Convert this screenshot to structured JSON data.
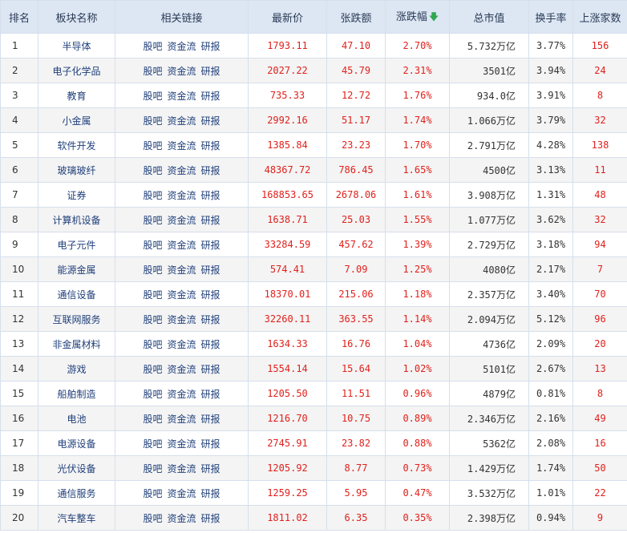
{
  "columns": [
    "排名",
    "板块名称",
    "相关链接",
    "最新价",
    "张跌额",
    "涨跌幅",
    "总市值",
    "换手率",
    "上涨家数"
  ],
  "sort_icon": "down-arrow-icon",
  "rows": [
    {
      "rank": "1",
      "name": "半导体",
      "links": [
        "股吧",
        "资金流",
        "研报"
      ],
      "price": "1793.11",
      "chg": "47.10",
      "pct": "2.70%",
      "cap": "5.732万亿",
      "turn": "3.77%",
      "up": "156"
    },
    {
      "rank": "2",
      "name": "电子化学品",
      "links": [
        "股吧",
        "资金流",
        "研报"
      ],
      "price": "2027.22",
      "chg": "45.79",
      "pct": "2.31%",
      "cap": "3501亿",
      "turn": "3.94%",
      "up": "24"
    },
    {
      "rank": "3",
      "name": "教育",
      "links": [
        "股吧",
        "资金流",
        "研报"
      ],
      "price": "735.33",
      "chg": "12.72",
      "pct": "1.76%",
      "cap": "934.0亿",
      "turn": "3.91%",
      "up": "8"
    },
    {
      "rank": "4",
      "name": "小金属",
      "links": [
        "股吧",
        "资金流",
        "研报"
      ],
      "price": "2992.16",
      "chg": "51.17",
      "pct": "1.74%",
      "cap": "1.066万亿",
      "turn": "3.79%",
      "up": "32"
    },
    {
      "rank": "5",
      "name": "软件开发",
      "links": [
        "股吧",
        "资金流",
        "研报"
      ],
      "price": "1385.84",
      "chg": "23.23",
      "pct": "1.70%",
      "cap": "2.791万亿",
      "turn": "4.28%",
      "up": "138"
    },
    {
      "rank": "6",
      "name": "玻璃玻纤",
      "links": [
        "股吧",
        "资金流",
        "研报"
      ],
      "price": "48367.72",
      "chg": "786.45",
      "pct": "1.65%",
      "cap": "4500亿",
      "turn": "3.13%",
      "up": "11"
    },
    {
      "rank": "7",
      "name": "证券",
      "links": [
        "股吧",
        "资金流",
        "研报"
      ],
      "price": "168853.65",
      "chg": "2678.06",
      "pct": "1.61%",
      "cap": "3.908万亿",
      "turn": "1.31%",
      "up": "48"
    },
    {
      "rank": "8",
      "name": "计算机设备",
      "links": [
        "股吧",
        "资金流",
        "研报"
      ],
      "price": "1638.71",
      "chg": "25.03",
      "pct": "1.55%",
      "cap": "1.077万亿",
      "turn": "3.62%",
      "up": "32"
    },
    {
      "rank": "9",
      "name": "电子元件",
      "links": [
        "股吧",
        "资金流",
        "研报"
      ],
      "price": "33284.59",
      "chg": "457.62",
      "pct": "1.39%",
      "cap": "2.729万亿",
      "turn": "3.18%",
      "up": "94"
    },
    {
      "rank": "10",
      "name": "能源金属",
      "links": [
        "股吧",
        "资金流",
        "研报"
      ],
      "price": "574.41",
      "chg": "7.09",
      "pct": "1.25%",
      "cap": "4080亿",
      "turn": "2.17%",
      "up": "7"
    },
    {
      "rank": "11",
      "name": "通信设备",
      "links": [
        "股吧",
        "资金流",
        "研报"
      ],
      "price": "18370.01",
      "chg": "215.06",
      "pct": "1.18%",
      "cap": "2.357万亿",
      "turn": "3.40%",
      "up": "70"
    },
    {
      "rank": "12",
      "name": "互联网服务",
      "links": [
        "股吧",
        "资金流",
        "研报"
      ],
      "price": "32260.11",
      "chg": "363.55",
      "pct": "1.14%",
      "cap": "2.094万亿",
      "turn": "5.12%",
      "up": "96"
    },
    {
      "rank": "13",
      "name": "非金属材料",
      "links": [
        "股吧",
        "资金流",
        "研报"
      ],
      "price": "1634.33",
      "chg": "16.76",
      "pct": "1.04%",
      "cap": "4736亿",
      "turn": "2.09%",
      "up": "20"
    },
    {
      "rank": "14",
      "name": "游戏",
      "links": [
        "股吧",
        "资金流",
        "研报"
      ],
      "price": "1554.14",
      "chg": "15.64",
      "pct": "1.02%",
      "cap": "5101亿",
      "turn": "2.67%",
      "up": "13"
    },
    {
      "rank": "15",
      "name": "船舶制造",
      "links": [
        "股吧",
        "资金流",
        "研报"
      ],
      "price": "1205.50",
      "chg": "11.51",
      "pct": "0.96%",
      "cap": "4879亿",
      "turn": "0.81%",
      "up": "8"
    },
    {
      "rank": "16",
      "name": "电池",
      "links": [
        "股吧",
        "资金流",
        "研报"
      ],
      "price": "1216.70",
      "chg": "10.75",
      "pct": "0.89%",
      "cap": "2.346万亿",
      "turn": "2.16%",
      "up": "49"
    },
    {
      "rank": "17",
      "name": "电源设备",
      "links": [
        "股吧",
        "资金流",
        "研报"
      ],
      "price": "2745.91",
      "chg": "23.82",
      "pct": "0.88%",
      "cap": "5362亿",
      "turn": "2.08%",
      "up": "16"
    },
    {
      "rank": "18",
      "name": "光伏设备",
      "links": [
        "股吧",
        "资金流",
        "研报"
      ],
      "price": "1205.92",
      "chg": "8.77",
      "pct": "0.73%",
      "cap": "1.429万亿",
      "turn": "1.74%",
      "up": "50"
    },
    {
      "rank": "19",
      "name": "通信服务",
      "links": [
        "股吧",
        "资金流",
        "研报"
      ],
      "price": "1259.25",
      "chg": "5.95",
      "pct": "0.47%",
      "cap": "3.532万亿",
      "turn": "1.01%",
      "up": "22"
    },
    {
      "rank": "20",
      "name": "汽车整车",
      "links": [
        "股吧",
        "资金流",
        "研报"
      ],
      "price": "1811.02",
      "chg": "6.35",
      "pct": "0.35%",
      "cap": "2.398万亿",
      "turn": "0.94%",
      "up": "9"
    }
  ]
}
